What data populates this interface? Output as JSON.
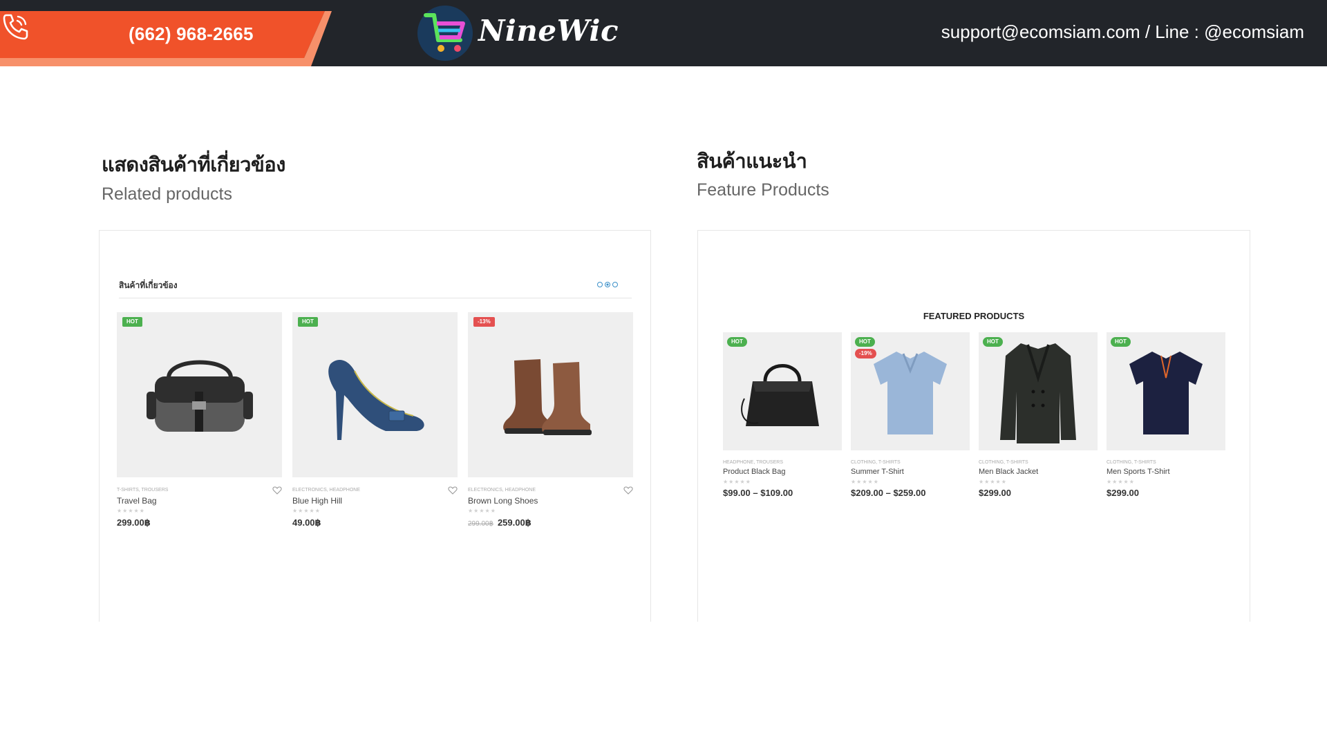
{
  "header": {
    "phone": "(662) 968-2665",
    "logo_text": "NineWic",
    "contact": "support@ecomsiam.com / Line : @ecomsiam",
    "colors": {
      "bar": "#22252a",
      "banner": "#f0522a",
      "banner_accent": "#f7906a"
    }
  },
  "related": {
    "title_th": "แสดงสินค้าที่เกี่ยวข้อง",
    "title_en": "Related products",
    "panel_heading": "สินค้าที่เกี่ยวข้อง",
    "products": [
      {
        "badge": "HOT",
        "category": "T-SHIRTS, TROUSERS",
        "name": "Travel Bag",
        "price": "299.00฿",
        "old_price": "",
        "rating": "★★★★★",
        "image": "travel-bag-icon"
      },
      {
        "badge": "HOT",
        "category": "ELECTRONICS, HEADPHONE",
        "name": "Blue High Hill",
        "price": "49.00฿",
        "old_price": "",
        "rating": "★★★★★",
        "image": "high-heel-icon"
      },
      {
        "badge": "-13%",
        "category": "ELECTRONICS, HEADPHONE",
        "name": "Brown Long Shoes",
        "price": "259.00฿",
        "old_price": "299.00฿",
        "rating": "★★★★★",
        "image": "boots-icon"
      }
    ]
  },
  "featured": {
    "title_th": "สินค้าแนะนำ",
    "title_en": "Feature Products",
    "panel_heading": "FEATURED PRODUCTS",
    "products": [
      {
        "badge": "HOT",
        "badge2": "",
        "category": "HEADPHONE, TROUSERS",
        "name": "Product Black Bag",
        "price": "$99.00 – $109.00",
        "rating": "★★★★★",
        "image": "handbag-icon"
      },
      {
        "badge": "HOT",
        "badge2": "-19%",
        "category": "CLOTHING, T-SHIRTS",
        "name": "Summer T-Shirt",
        "price": "$209.00 – $259.00",
        "rating": "★★★★★",
        "image": "polo-shirt-icon"
      },
      {
        "badge": "HOT",
        "badge2": "",
        "category": "CLOTHING, T-SHIRTS",
        "name": "Men Black Jacket",
        "price": "$299.00",
        "rating": "★★★★★",
        "image": "jacket-icon"
      },
      {
        "badge": "HOT",
        "badge2": "",
        "category": "CLOTHING, T-SHIRTS",
        "name": "Men Sports T-Shirt",
        "price": "$299.00",
        "rating": "★★★★★",
        "image": "polo-shirt-icon"
      }
    ]
  }
}
